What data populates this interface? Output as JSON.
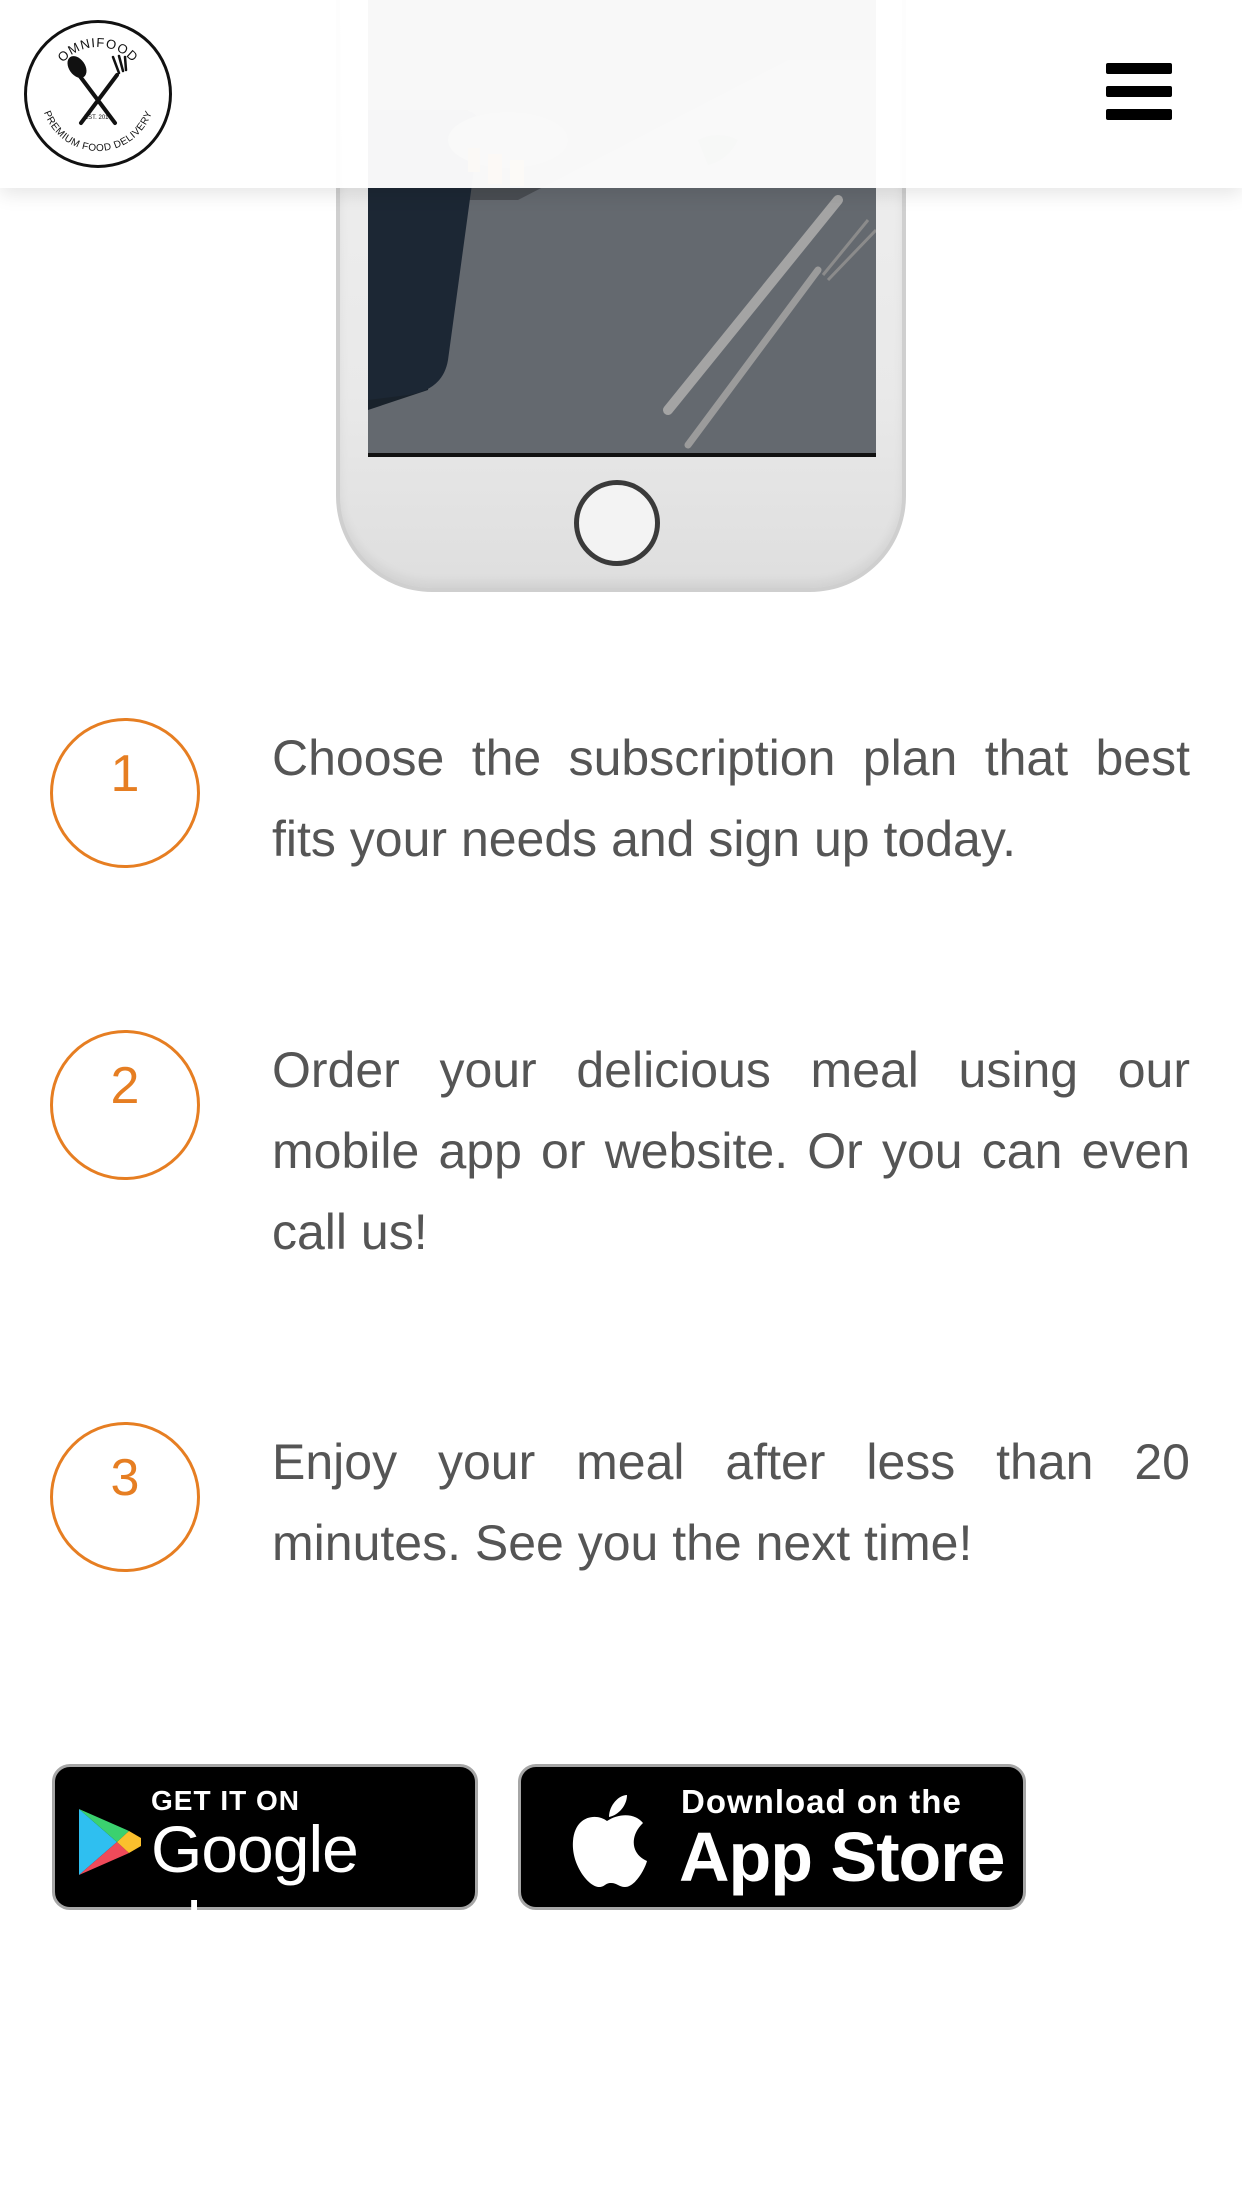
{
  "header": {
    "logo": {
      "top_text": "OMNIFOOD",
      "bottom_text": "PREMIUM FOOD DELIVERY",
      "est": "EST. 2014"
    },
    "menu_icon": "hamburger-menu-icon"
  },
  "steps": [
    {
      "number": "1",
      "text": "Choose the subscription plan that best fits your needs and sign up today."
    },
    {
      "number": "2",
      "text": "Order your delicious meal using our mobile app or website. Or you can even call us!"
    },
    {
      "number": "3",
      "text": "Enjoy your meal after less than 20 minutes. See you the next time!"
    }
  ],
  "badges": {
    "google": {
      "small": "GET IT ON",
      "big": "Google play"
    },
    "apple": {
      "small": "Download on the",
      "big": "App Store"
    }
  },
  "colors": {
    "accent": "#e67e22",
    "text": "#555555",
    "badge_bg": "#000000"
  }
}
